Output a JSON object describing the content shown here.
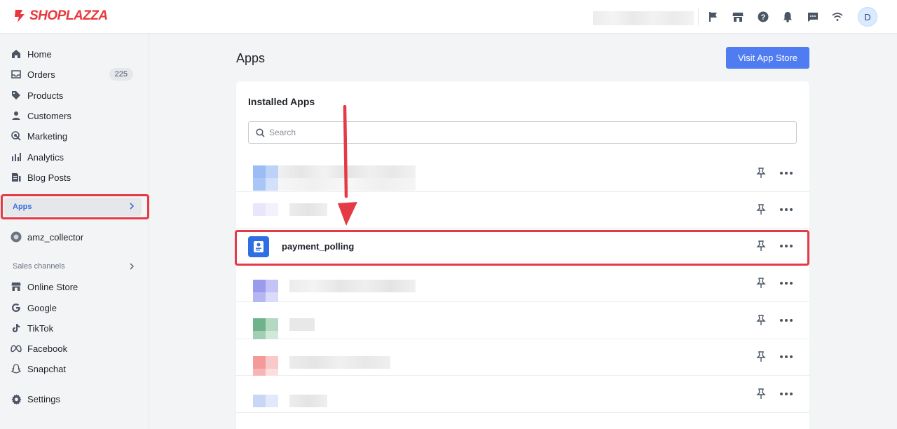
{
  "brand": {
    "name": "SHOPLAZZA",
    "color": "#e8383d"
  },
  "header": {
    "icons": [
      "flag-icon",
      "store-icon",
      "help-icon",
      "bell-icon",
      "chat-icon",
      "wifi-icon"
    ],
    "avatar_initial": "D"
  },
  "sidebar": {
    "items": [
      {
        "label": "Home",
        "icon": "home-icon"
      },
      {
        "label": "Orders",
        "icon": "inbox-icon",
        "badge": "225"
      },
      {
        "label": "Products",
        "icon": "tag-icon"
      },
      {
        "label": "Customers",
        "icon": "person-icon"
      },
      {
        "label": "Marketing",
        "icon": "target-icon"
      },
      {
        "label": "Analytics",
        "icon": "bar-chart-icon"
      },
      {
        "label": "Blog Posts",
        "icon": "blog-icon"
      }
    ],
    "apps": {
      "label": "Apps",
      "accent": "#3b6fd9"
    },
    "installed_app": {
      "label": "amz_collector",
      "icon": "app-circle-icon"
    },
    "sales_channels": {
      "label": "Sales channels",
      "items": [
        {
          "label": "Online Store",
          "icon": "store-icon"
        },
        {
          "label": "Google",
          "icon": "google-icon"
        },
        {
          "label": "TikTok",
          "icon": "tiktok-icon"
        },
        {
          "label": "Facebook",
          "icon": "meta-icon"
        },
        {
          "label": "Snapchat",
          "icon": "snapchat-icon"
        }
      ]
    },
    "settings": {
      "label": "Settings",
      "icon": "gear-icon"
    }
  },
  "main": {
    "title": "Apps",
    "visit_button": "Visit App Store",
    "card": {
      "title": "Installed Apps",
      "search_placeholder": "Search",
      "highlighted_app": {
        "name": "payment_polling"
      }
    }
  },
  "colors": {
    "highlight": "#e63946",
    "primary": "#4f7cf0"
  }
}
